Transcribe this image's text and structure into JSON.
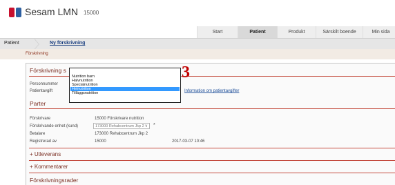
{
  "app": {
    "title": "Sesam LMN",
    "version": "15000"
  },
  "tabs": [
    {
      "label": "Start",
      "active": false
    },
    {
      "label": "Patient",
      "active": true
    },
    {
      "label": "Produkt",
      "active": false
    },
    {
      "label": "Särskilt boende",
      "active": false
    },
    {
      "label": "Min sida",
      "active": false
    }
  ],
  "breadcrumb": {
    "root": "Patient",
    "current": "Ny förskrivning"
  },
  "subnav": {
    "label": "Förskrivning"
  },
  "form": {
    "section_title": "Förskrivning s",
    "personnummer_label": "Personnummer",
    "patientavgift_label": "Patientavgift",
    "patientavgift_link": "Information om patientavgifter"
  },
  "parter": {
    "title": "Parter",
    "forskrivare_label": "Förskrivare",
    "forskrivare_value": "15000 Förskrivare nutrition",
    "enhet_label": "Förskrivande enhet (kund)",
    "enhet_selected": "173000 Rehabcentrum Jkp 2",
    "required_mark": "*",
    "betalare_label": "Betalare",
    "betalare_value": "173000 Rehabcentrum Jkp 2",
    "registrerad_label": "Registrerad av",
    "registrerad_value": "15000",
    "registrerad_date": "2017-03-07 10:46"
  },
  "collapsibles": {
    "utleverans": "+ Utleverans",
    "kommentarer": "+ Kommentarer"
  },
  "rows_title": "Förskrivningsrader",
  "dropdown": {
    "options": [
      "Nutrition barn",
      "Halvnutrition",
      "Specialnutrition",
      "Helnutrition",
      "Tilläggsnutrition"
    ],
    "selected": "Helnutrition"
  },
  "annotation": "3",
  "colors": {
    "accent_red": "#c44a3c",
    "section_text": "#7a2e22",
    "link_blue": "#1f4f9a",
    "selection_blue": "#3399ff",
    "logo_red": "#c8102e",
    "logo_blue": "#2d5fa0"
  }
}
